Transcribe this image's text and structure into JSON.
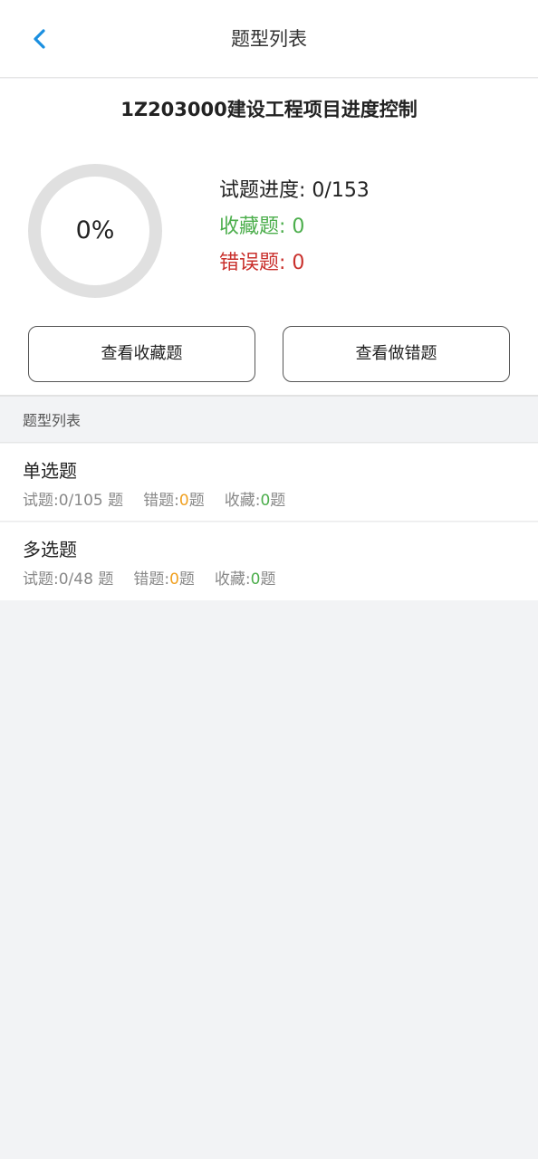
{
  "header": {
    "title": "题型列表"
  },
  "summary": {
    "course_title": "1Z203000建设工程项目进度控制",
    "progress_percent": 0,
    "progress_text": "0%",
    "stat_progress_label": "试题进度: ",
    "stat_progress_value": "0/153",
    "stat_fav_label": "收藏题: ",
    "stat_fav_value": "0",
    "stat_wrong_label": "错误题: ",
    "stat_wrong_value": "0",
    "btn_view_fav": "查看收藏题",
    "btn_view_wrong": "查看做错题"
  },
  "section": {
    "label": "题型列表"
  },
  "items": [
    {
      "title": "单选题",
      "progress_label": "试题:",
      "progress_value": "0/105 题",
      "wrong_label": "错题:",
      "wrong_value": "0",
      "wrong_suffix": "题",
      "fav_label": "收藏:",
      "fav_value": "0",
      "fav_suffix": "题"
    },
    {
      "title": "多选题",
      "progress_label": "试题:",
      "progress_value": "0/48 题",
      "wrong_label": "错题:",
      "wrong_value": "0",
      "wrong_suffix": "题",
      "fav_label": "收藏:",
      "fav_value": "0",
      "fav_suffix": "题"
    }
  ],
  "colors": {
    "accent": "#1a8fe0",
    "favorite": "#4cae4c",
    "wrong": "#c9302c",
    "wrong_count": "#f0a020",
    "ring_track": "#e0e0e0"
  },
  "icons": {
    "back": "chevron-left-icon"
  }
}
